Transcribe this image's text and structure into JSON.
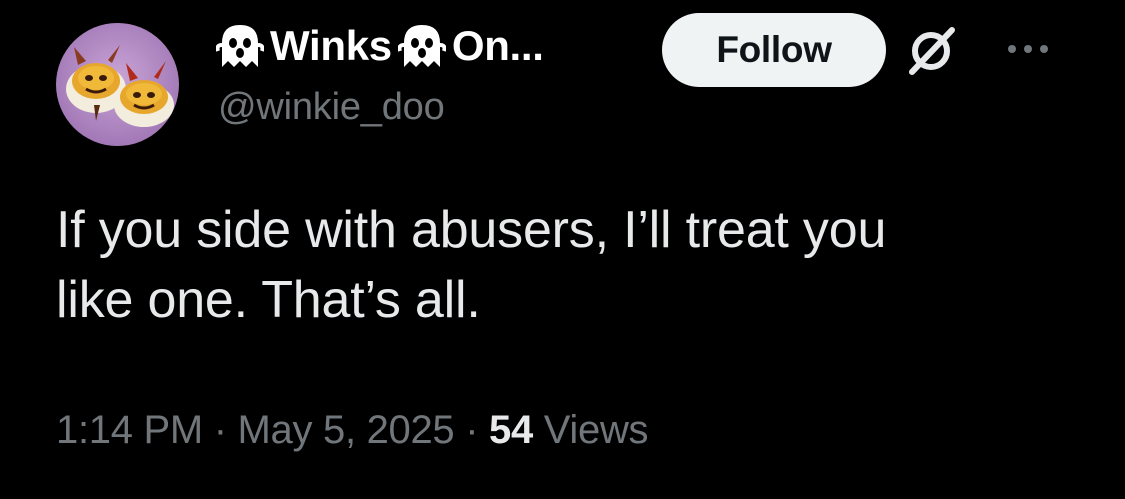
{
  "author": {
    "display_name": "Winks",
    "display_name_suffix": "On...",
    "handle": "@winkie_doo",
    "name_emoji": "ghost-emoji",
    "avatar": "deviled-egg-devils-avatar"
  },
  "actions": {
    "follow_label": "Follow",
    "grok_icon": "grok-icon",
    "more_icon": "more-options-icon"
  },
  "tweet": {
    "text_lines": [
      "If you side with abusers, I’ll treat you",
      "like one. That’s all."
    ],
    "time": "1:14 PM",
    "separator": " · ",
    "date": "May 5, 2025",
    "views_count": "54",
    "views_label": " Views"
  },
  "colors": {
    "background": "#000000",
    "primary_text": "#e7e9ea",
    "secondary_text": "#71767b",
    "follow_bg": "#eff3f4",
    "follow_text": "#0f1419",
    "avatar_bg": "#b48fc4"
  }
}
